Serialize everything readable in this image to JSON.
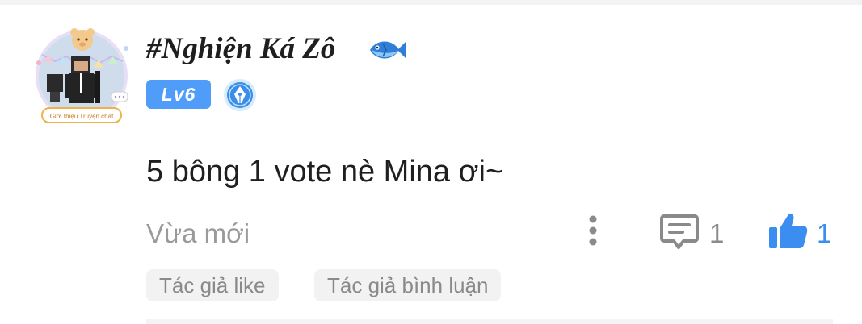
{
  "comment": {
    "user": {
      "name": "#Nghiện Ká Zô",
      "level": "Lv6",
      "avatar_frame_label": "Giới thiệu Truyện chat"
    },
    "text": "5 bông 1 vote nè Mina ơi~",
    "timestamp": "Vừa mới",
    "reply_count": "1",
    "like_count": "1",
    "tags": [
      "Tác giả like",
      "Tác giả bình luận"
    ]
  },
  "colors": {
    "accent": "#3b8ef0",
    "level_badge": "#4f9cf9",
    "muted_text": "#9a9a9a",
    "tag_bg": "#f2f2f2"
  },
  "icons": {
    "more": "more-vertical-icon",
    "reply": "comment-icon",
    "like": "thumbs-up-icon",
    "fish": "fish-icon",
    "pen_badge": "fountain-pen-badge-icon"
  }
}
